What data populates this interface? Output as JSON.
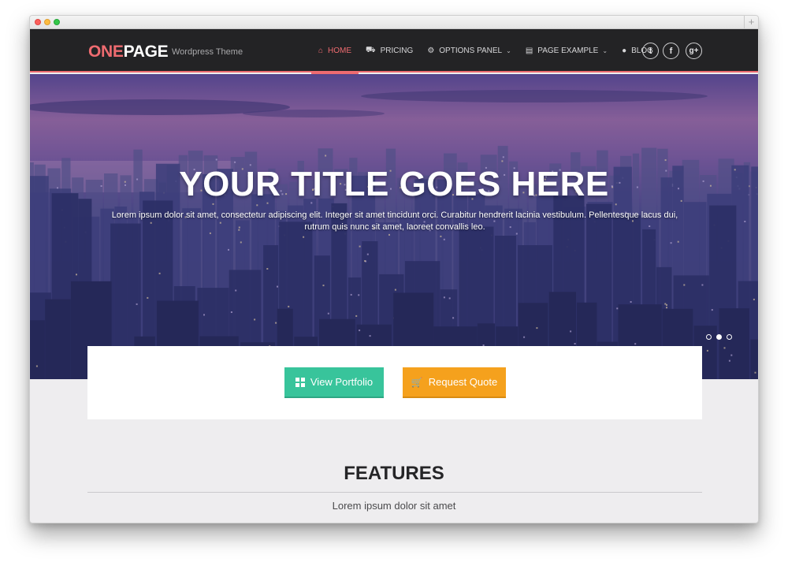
{
  "window": {
    "plus": "+"
  },
  "brand": {
    "name_part1": "ONE",
    "name_part2": "PAGE",
    "tagline": "Wordpress Theme"
  },
  "nav": {
    "items": [
      {
        "label": "HOME",
        "icon": "home-icon",
        "glyph": "⌂",
        "active": true,
        "dropdown": false
      },
      {
        "label": "PRICING",
        "icon": "cart-icon",
        "glyph": "⛟",
        "active": false,
        "dropdown": false
      },
      {
        "label": "OPTIONS PANEL",
        "icon": "gears-icon",
        "glyph": "⚙",
        "active": false,
        "dropdown": true
      },
      {
        "label": "PAGE EXAMPLE",
        "icon": "file-icon",
        "glyph": "▤",
        "active": false,
        "dropdown": true
      },
      {
        "label": "BLOG",
        "icon": "chat-icon",
        "glyph": "●",
        "active": false,
        "dropdown": false
      }
    ],
    "chevron": "⌄",
    "social": [
      {
        "name": "twitter",
        "glyph": "t"
      },
      {
        "name": "facebook",
        "glyph": "f"
      },
      {
        "name": "google-plus",
        "glyph": "g+"
      }
    ]
  },
  "hero": {
    "title": "YOUR TITLE GOES HERE",
    "text": "Lorem ipsum dolor sit amet, consectetur adipiscing elit. Integer sit amet tincidunt orci. Curabitur hendrerit lacinia vestibulum. Pellentesque lacus dui, rutrum quis nunc sit amet, laoreet convallis leo.",
    "slides": 3,
    "active_slide": 2
  },
  "cta": {
    "portfolio_label": "View Portfolio",
    "quote_label": "Request Quote",
    "quote_glyph": "🛒"
  },
  "features": {
    "title": "FEATURES",
    "subtitle": "Lorem ipsum dolor sit amet"
  },
  "colors": {
    "accent": "#ee6b70",
    "green": "#38c49b",
    "orange": "#f5a11d",
    "navbar": "#232325"
  }
}
